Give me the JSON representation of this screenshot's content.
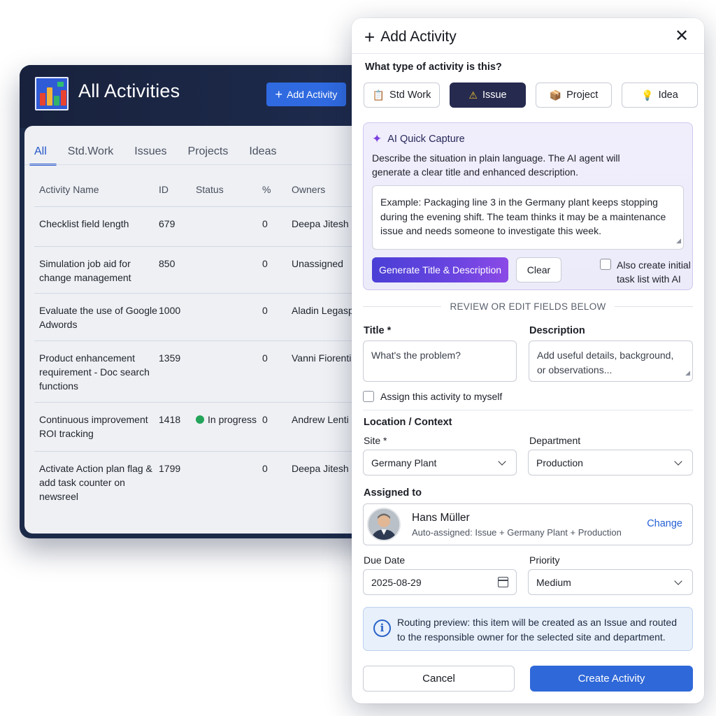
{
  "background_app": {
    "title": "All Activities",
    "add_button_label": "Add Activity",
    "tabs": [
      {
        "label": "All",
        "active": true
      },
      {
        "label": "Std.Work",
        "active": false
      },
      {
        "label": "Issues",
        "active": false
      },
      {
        "label": "Projects",
        "active": false
      },
      {
        "label": "Ideas",
        "active": false
      }
    ],
    "table": {
      "headers": [
        "Activity Name",
        "ID",
        "Status",
        "%",
        "Owners"
      ],
      "rows": [
        {
          "name": "Checklist field length",
          "id": "679",
          "status": "",
          "pct": "0",
          "owner": "Deepa Jitesh"
        },
        {
          "name": "Simulation job aid for change management",
          "id": "850",
          "status": "",
          "pct": "0",
          "owner": "Unassigned"
        },
        {
          "name": "Evaluate the use of Google Adwords",
          "id": "1000",
          "status": "",
          "pct": "0",
          "owner": "Aladin Legaspi"
        },
        {
          "name": "Product enhancement requirement - Doc search functions",
          "id": "1359",
          "status": "",
          "pct": "0",
          "owner": "Vanni Fiorentino"
        },
        {
          "name": "Continuous improvement ROI tracking",
          "id": "1418",
          "status": "In progress",
          "pct": "0",
          "owner": "Andrew Lenti"
        },
        {
          "name": "Activate Action plan flag & add task counter on newsreel",
          "id": "1799",
          "status": "",
          "pct": "0",
          "owner": "Deepa Jitesh"
        }
      ]
    },
    "status_color": "#23a45a"
  },
  "modal": {
    "title": "Add Activity",
    "type_question": "What type of activity is this?",
    "types": [
      {
        "label": "Std Work",
        "icon": "clipboard-icon",
        "active": false
      },
      {
        "label": "Issue",
        "icon": "warning-icon",
        "active": true
      },
      {
        "label": "Project",
        "icon": "package-icon",
        "active": false
      },
      {
        "label": "Idea",
        "icon": "lightbulb-icon",
        "active": false
      }
    ],
    "ai": {
      "heading": "AI Quick Capture",
      "description": "Describe the situation in plain language. The AI agent will generate a clear title and enhanced description.",
      "placeholder": "Example: Packaging line 3 in the Germany plant keeps stopping during the evening shift. The team thinks it may be a maintenance issue and needs someone to investigate this week.",
      "generate_label": "Generate Title & Description",
      "clear_label": "Clear",
      "task_list_label": "Also create initial task list with AI"
    },
    "review_label": "REVIEW OR EDIT FIELDS BELOW",
    "title_field": {
      "label": "Title *",
      "placeholder": "What's the problem?"
    },
    "description_field": {
      "label": "Description",
      "placeholder": "Add useful details, background, or observations..."
    },
    "assign_self_label": "Assign this activity to myself",
    "location_heading": "Location / Context",
    "site": {
      "label": "Site *",
      "value": "Germany Plant"
    },
    "department": {
      "label": "Department",
      "value": "Production"
    },
    "assigned_to": {
      "label": "Assigned to",
      "name": "Hans Müller",
      "sub": "Auto-assigned: Issue + Germany Plant + Production",
      "change_label": "Change"
    },
    "due_date": {
      "label": "Due Date",
      "value": "2025-08-29"
    },
    "priority": {
      "label": "Priority",
      "value": "Medium"
    },
    "routing_preview": "Routing preview: this item will be created as an Issue and routed to the responsible owner for the selected site and department.",
    "cancel_label": "Cancel",
    "create_label": "Create Activity",
    "colors": {
      "primary": "#2f68d8",
      "active_type": "#262a4e",
      "ai_gradient_start": "#4a3fd6",
      "ai_gradient_end": "#8b4ae6"
    }
  }
}
